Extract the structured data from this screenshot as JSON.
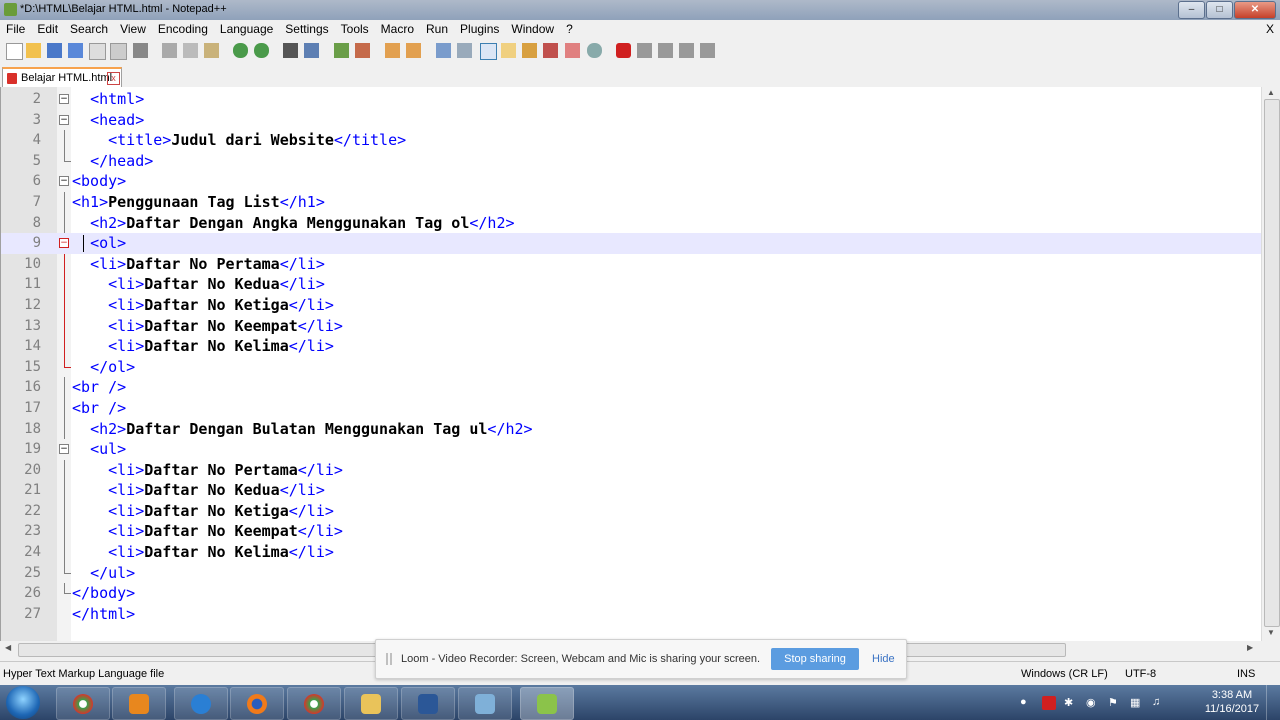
{
  "window": {
    "title": "*D:\\HTML\\Belajar HTML.html - Notepad++"
  },
  "menu": [
    "File",
    "Edit",
    "Search",
    "View",
    "Encoding",
    "Language",
    "Settings",
    "Tools",
    "Macro",
    "Run",
    "Plugins",
    "Window",
    "?"
  ],
  "menu_close": "X",
  "tab": {
    "label": "Belajar HTML.html",
    "close": "x"
  },
  "editor": {
    "lines": [
      {
        "n": "2",
        "indent": "  ",
        "parts": [
          [
            "tag",
            "<html>"
          ]
        ]
      },
      {
        "n": "3",
        "indent": "  ",
        "parts": [
          [
            "tag",
            "<head>"
          ]
        ]
      },
      {
        "n": "4",
        "indent": "    ",
        "parts": [
          [
            "tag",
            "<title>"
          ],
          [
            "content",
            "Judul dari Website"
          ],
          [
            "tag",
            "</title>"
          ]
        ]
      },
      {
        "n": "5",
        "indent": "  ",
        "parts": [
          [
            "tag",
            "</head>"
          ]
        ]
      },
      {
        "n": "6",
        "indent": "",
        "parts": [
          [
            "tag",
            "<body>"
          ]
        ]
      },
      {
        "n": "7",
        "indent": "",
        "parts": [
          [
            "tag",
            "<h1>"
          ],
          [
            "content",
            "Penggunaan Tag List"
          ],
          [
            "tag",
            "</h1>"
          ]
        ]
      },
      {
        "n": "8",
        "indent": "  ",
        "parts": [
          [
            "tag",
            "<h2>"
          ],
          [
            "content",
            "Daftar Dengan Angka Menggunakan Tag ol"
          ],
          [
            "tag",
            "</h2>"
          ]
        ]
      },
      {
        "n": "9",
        "indent": "  ",
        "parts": [
          [
            "tag",
            "<ol>"
          ]
        ]
      },
      {
        "n": "10",
        "indent": "  ",
        "parts": [
          [
            "tag",
            "<li>"
          ],
          [
            "content",
            "Daftar No Pertama"
          ],
          [
            "tag",
            "</li>"
          ]
        ]
      },
      {
        "n": "11",
        "indent": "    ",
        "parts": [
          [
            "tag",
            "<li>"
          ],
          [
            "content",
            "Daftar No Kedua"
          ],
          [
            "tag",
            "</li>"
          ]
        ]
      },
      {
        "n": "12",
        "indent": "    ",
        "parts": [
          [
            "tag",
            "<li>"
          ],
          [
            "content",
            "Daftar No Ketiga"
          ],
          [
            "tag",
            "</li>"
          ]
        ]
      },
      {
        "n": "13",
        "indent": "    ",
        "parts": [
          [
            "tag",
            "<li>"
          ],
          [
            "content",
            "Daftar No Keempat"
          ],
          [
            "tag",
            "</li>"
          ]
        ]
      },
      {
        "n": "14",
        "indent": "    ",
        "parts": [
          [
            "tag",
            "<li>"
          ],
          [
            "content",
            "Daftar No Kelima"
          ],
          [
            "tag",
            "</li>"
          ]
        ]
      },
      {
        "n": "15",
        "indent": "  ",
        "parts": [
          [
            "tag",
            "</ol>"
          ]
        ]
      },
      {
        "n": "16",
        "indent": "",
        "parts": [
          [
            "tag",
            "<br />"
          ]
        ]
      },
      {
        "n": "17",
        "indent": "",
        "parts": [
          [
            "tag",
            "<br />"
          ]
        ]
      },
      {
        "n": "18",
        "indent": "  ",
        "parts": [
          [
            "tag",
            "<h2>"
          ],
          [
            "content",
            "Daftar Dengan Bulatan Menggunakan Tag ul"
          ],
          [
            "tag",
            "</h2>"
          ]
        ]
      },
      {
        "n": "19",
        "indent": "  ",
        "parts": [
          [
            "tag",
            "<ul>"
          ]
        ]
      },
      {
        "n": "20",
        "indent": "    ",
        "parts": [
          [
            "tag",
            "<li>"
          ],
          [
            "content",
            "Daftar No Pertama"
          ],
          [
            "tag",
            "</li>"
          ]
        ]
      },
      {
        "n": "21",
        "indent": "    ",
        "parts": [
          [
            "tag",
            "<li>"
          ],
          [
            "content",
            "Daftar No Kedua"
          ],
          [
            "tag",
            "</li>"
          ]
        ]
      },
      {
        "n": "22",
        "indent": "    ",
        "parts": [
          [
            "tag",
            "<li>"
          ],
          [
            "content",
            "Daftar No Ketiga"
          ],
          [
            "tag",
            "</li>"
          ]
        ]
      },
      {
        "n": "23",
        "indent": "    ",
        "parts": [
          [
            "tag",
            "<li>"
          ],
          [
            "content",
            "Daftar No Keempat"
          ],
          [
            "tag",
            "</li>"
          ]
        ]
      },
      {
        "n": "24",
        "indent": "    ",
        "parts": [
          [
            "tag",
            "<li>"
          ],
          [
            "content",
            "Daftar No Kelima"
          ],
          [
            "tag",
            "</li>"
          ]
        ]
      },
      {
        "n": "25",
        "indent": "  ",
        "parts": [
          [
            "tag",
            "</ul>"
          ]
        ]
      },
      {
        "n": "26",
        "indent": "",
        "parts": [
          [
            "tag",
            "</body>"
          ]
        ]
      },
      {
        "n": "27",
        "indent": "",
        "parts": [
          [
            "tag",
            "</html>"
          ]
        ]
      }
    ],
    "current_line": "9",
    "fold_markers": {
      "2": "box",
      "3": "box",
      "6": "box",
      "9": "box-red",
      "19": "box"
    },
    "colors": {
      "tag": "#0000ff",
      "content": "#000000",
      "current_line_bg": "#e8e8ff"
    }
  },
  "status": {
    "file_type": "Hyper Text Markup Language file",
    "eol": "Windows (CR LF)",
    "encoding": "UTF-8",
    "mode": "INS"
  },
  "loom": {
    "message": "Loom - Video Recorder: Screen, Webcam and Mic is sharing your screen.",
    "stop_label": "Stop sharing",
    "hide_label": "Hide"
  },
  "taskbar": {
    "apps": [
      "chrome-icon",
      "media-player-icon",
      "ie-icon",
      "firefox-icon",
      "chrome-icon",
      "explorer-icon",
      "word-icon",
      "paint-icon",
      "notepad-plus-plus-icon"
    ],
    "clock_time": "3:38 AM",
    "clock_date": "11/16/2017"
  }
}
